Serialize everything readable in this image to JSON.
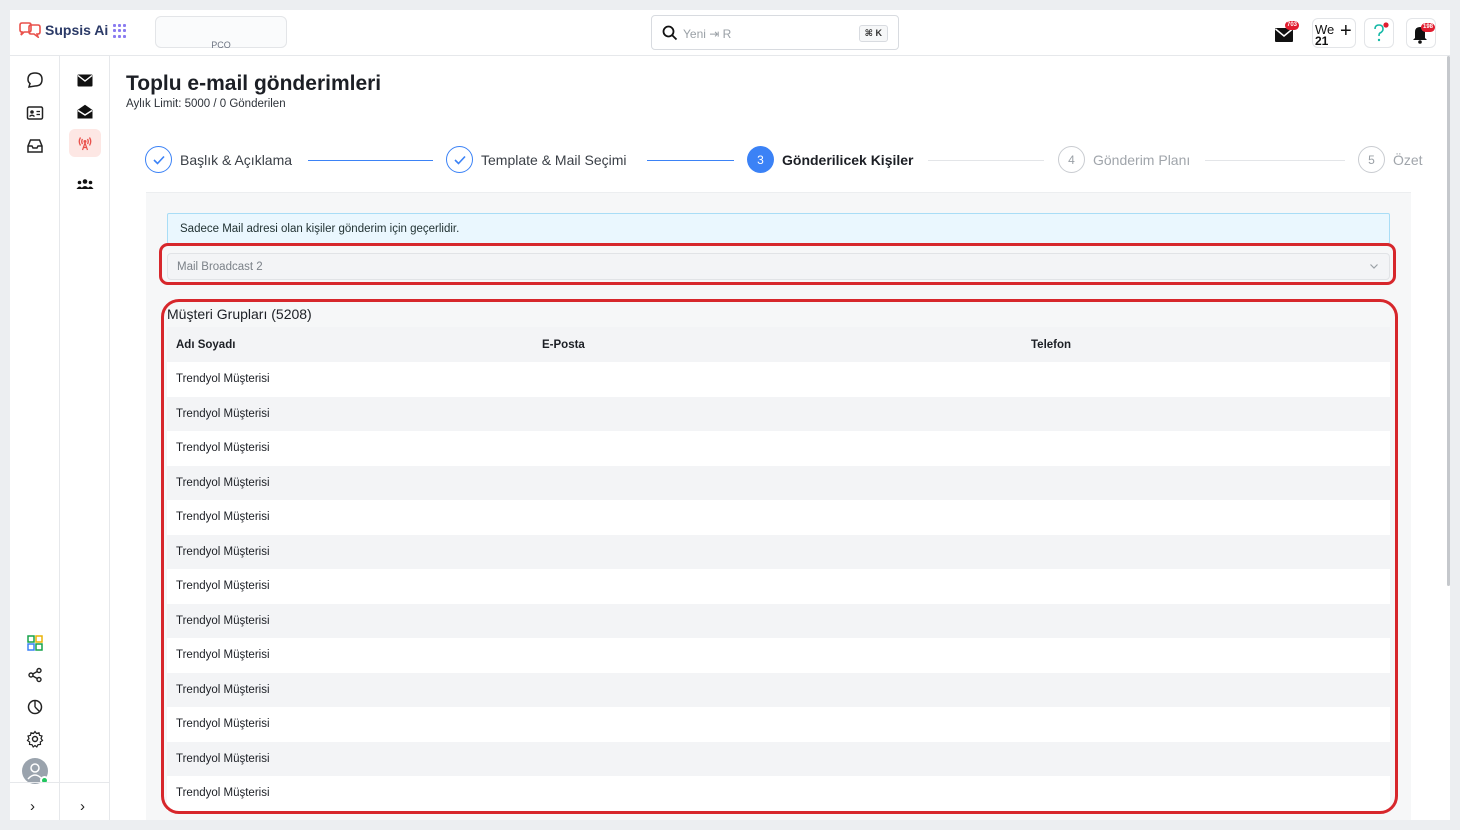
{
  "app": {
    "name": "Supsis Ai",
    "org_label": "PCO"
  },
  "search": {
    "placeholder": "Yeni ⇥ R",
    "shortcut": "⌘ K"
  },
  "topbar": {
    "mail_badge": "703",
    "calendar_top": "We",
    "calendar_day": "21",
    "notif_badge": "198"
  },
  "rail1_icons": [
    "chat-icon",
    "contact-card-icon",
    "inbox-icon",
    "dashboard-icon",
    "share-icon",
    "clock-icon",
    "settings-icon"
  ],
  "rail2_icons": [
    "mail-icon",
    "mail-open-icon",
    "broadcast-icon",
    "group-icon"
  ],
  "page": {
    "title": "Toplu e-mail gönderimleri",
    "subtitle": "Aylık Limit: 5000 / 0 Gönderilen"
  },
  "steps": [
    {
      "marker": "",
      "label": "Başlık & Açıklama",
      "state": "done"
    },
    {
      "marker": "",
      "label": "Template & Mail Seçimi",
      "state": "done"
    },
    {
      "marker": "3",
      "label": "Gönderilicek Kişiler",
      "state": "current"
    },
    {
      "marker": "4",
      "label": "Gönderim Planı",
      "state": "todo"
    },
    {
      "marker": "5",
      "label": "Özet",
      "state": "todo"
    }
  ],
  "info_message": "Sadece Mail adresi olan kişiler gönderim için geçerlidir.",
  "broadcast_select": {
    "value": "Mail Broadcast 2"
  },
  "groups": {
    "title": "Müşteri Grupları (5208)",
    "columns": [
      "Adı Soyadı",
      "E-Posta",
      "Telefon"
    ],
    "rows": [
      [
        "Trendyol Müşterisi",
        "",
        ""
      ],
      [
        "Trendyol Müşterisi",
        "",
        ""
      ],
      [
        "Trendyol Müşterisi",
        "",
        ""
      ],
      [
        "Trendyol Müşterisi",
        "",
        ""
      ],
      [
        "Trendyol Müşterisi",
        "",
        ""
      ],
      [
        "Trendyol Müşterisi",
        "",
        ""
      ],
      [
        "Trendyol Müşterisi",
        "",
        ""
      ],
      [
        "Trendyol Müşterisi",
        "",
        ""
      ],
      [
        "Trendyol Müşterisi",
        "",
        ""
      ],
      [
        "Trendyol Müşterisi",
        "",
        ""
      ],
      [
        "Trendyol Müşterisi",
        "",
        ""
      ],
      [
        "Trendyol Müşterisi",
        "",
        ""
      ],
      [
        "Trendyol Müşterisi",
        "",
        ""
      ]
    ]
  },
  "colors": {
    "accent": "#3b82f6",
    "highlight": "#d7272c",
    "brand": "#2b3a67",
    "alert": "#e11d2f"
  }
}
